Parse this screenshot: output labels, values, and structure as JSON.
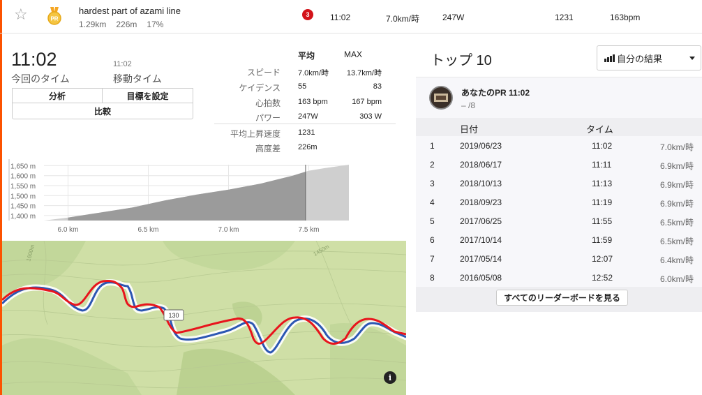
{
  "segment": {
    "title": "hardest part of azami line",
    "distance": "1.29km",
    "elevation": "226m",
    "grade": "17%",
    "medal": "PR",
    "rank": "3"
  },
  "summary_row": {
    "time": "11:02",
    "speed": "7.0km/時",
    "power": "247W",
    "vam": "1231",
    "heartrate": "163bpm"
  },
  "effort": {
    "elapsed_time": "11:02",
    "elapsed_label": "今回のタイム",
    "moving_time": "11:02",
    "moving_label": "移動タイム",
    "buttons": {
      "analyze": "分析",
      "goal": "目標を設定",
      "compare": "比較"
    }
  },
  "stats": {
    "avg_header": "平均",
    "max_header": "MAX",
    "rows": [
      {
        "label": "スピード",
        "avg": "7.0km/時",
        "max": "13.7km/時"
      },
      {
        "label": "ケイデンス",
        "avg": "55",
        "max": "83"
      },
      {
        "label": "心拍数",
        "avg": "163 bpm",
        "max": "167 bpm"
      },
      {
        "label": "パワー",
        "avg": "247W",
        "max": "303 W"
      },
      {
        "label": "平均上昇速度",
        "avg": "1231",
        "max": ""
      },
      {
        "label": "高度差",
        "avg": "226m",
        "max": ""
      }
    ]
  },
  "chart_data": {
    "type": "area",
    "y_ticks": [
      "1,650 m",
      "1,600 m",
      "1,550 m",
      "1,500 m",
      "1,450 m",
      "1,400 m"
    ],
    "x_ticks": [
      "6.0 km",
      "6.5 km",
      "7.0 km",
      "7.5 km"
    ],
    "ylim": [
      1375,
      1655
    ],
    "xlim": [
      5.85,
      7.75
    ],
    "x": [
      5.85,
      6.0,
      6.2,
      6.4,
      6.6,
      6.8,
      7.0,
      7.2,
      7.4,
      7.5,
      7.6,
      7.75
    ],
    "y": [
      1375,
      1390,
      1415,
      1440,
      1475,
      1505,
      1530,
      1560,
      1600,
      1625,
      1638,
      1655
    ],
    "highlight_range": [
      6.0,
      7.48
    ]
  },
  "map": {
    "route_label": "130",
    "contour_labels": [
      "1600m",
      "1450m"
    ],
    "info_icon": "i",
    "colors": {
      "land": "#cfdfa6",
      "forest": "#b9cf8e",
      "route_red": "#e8141c",
      "route_blue": "#2c57b3"
    }
  },
  "leaderboard": {
    "title": "トップ 10",
    "filter": "自分の結果",
    "pr_title": "あなたのPR 11:02",
    "pr_sub": "– /8",
    "columns": {
      "date": "日付",
      "time": "タイム"
    },
    "rows": [
      {
        "rank": "1",
        "date": "2019/06/23",
        "time": "11:02",
        "speed": "7.0km/時"
      },
      {
        "rank": "2",
        "date": "2018/06/17",
        "time": "11:11",
        "speed": "6.9km/時"
      },
      {
        "rank": "3",
        "date": "2018/10/13",
        "time": "11:13",
        "speed": "6.9km/時"
      },
      {
        "rank": "4",
        "date": "2018/09/23",
        "time": "11:19",
        "speed": "6.9km/時"
      },
      {
        "rank": "5",
        "date": "2017/06/25",
        "time": "11:55",
        "speed": "6.5km/時"
      },
      {
        "rank": "6",
        "date": "2017/10/14",
        "time": "11:59",
        "speed": "6.5km/時"
      },
      {
        "rank": "7",
        "date": "2017/05/14",
        "time": "12:07",
        "speed": "6.4km/時"
      },
      {
        "rank": "8",
        "date": "2016/05/08",
        "time": "12:52",
        "speed": "6.0km/時"
      }
    ],
    "view_all": "すべてのリーダーボードを見る"
  }
}
